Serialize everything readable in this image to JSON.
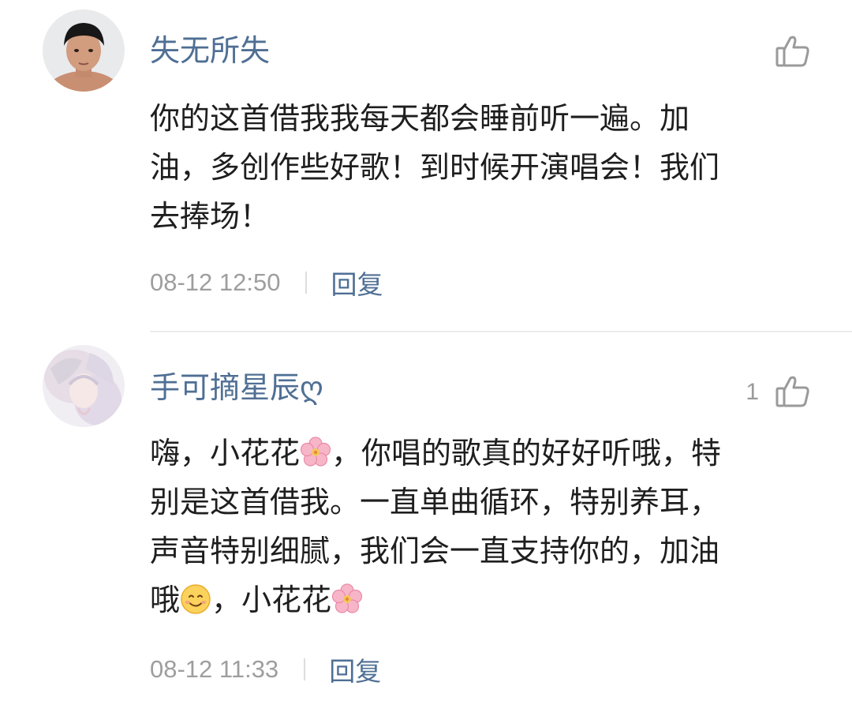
{
  "comments": [
    {
      "username": "失无所失",
      "like_count": "",
      "lines": [
        "你的这首借我我每天都会睡前听一遍。加",
        "油，多创作些好歌！到时候开演唱会！我们",
        "去捧场！"
      ],
      "time": "08-12 12:50",
      "reply_label": "回复"
    },
    {
      "username": "手可摘星辰ღ",
      "like_count": "1",
      "lines": [
        [
          "嗨，小花花",
          "，你唱的歌真的好好听哦，特"
        ],
        "别是这首借我。一直单曲循环，特别养耳，",
        "声音特别细腻，我们会一直支持你的，加油",
        [
          "哦",
          "，小花花",
          ""
        ]
      ],
      "time": "08-12 11:33",
      "reply_label": "回复"
    }
  ],
  "icons": {
    "like": "thumbs-up-icon",
    "flower_emoji": "cherry-blossom-icon",
    "smile_emoji": "smiling-face-icon"
  },
  "colors": {
    "username": "#4f6f94",
    "reply": "#4f6f94",
    "body_text": "#1e1e1e",
    "meta_text": "#9e9e9e",
    "divider": "#ececec"
  }
}
